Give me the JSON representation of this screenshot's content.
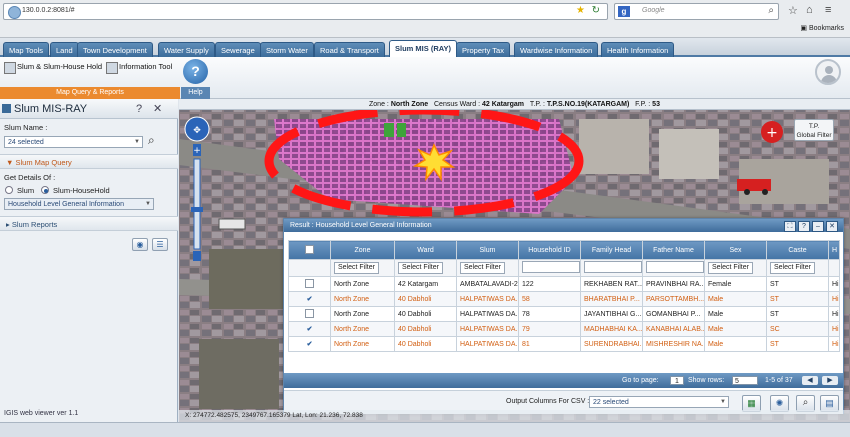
{
  "browser": {
    "url": "130.0.0.2:8081/#",
    "search_placeholder": "Google",
    "bookmarks_label": "Bookmarks"
  },
  "tabs": [
    {
      "label": "Map Tools"
    },
    {
      "label": "Land"
    },
    {
      "label": "Town Development"
    },
    {
      "label": "Water Supply"
    },
    {
      "label": "Sewerage"
    },
    {
      "label": "Storm Water"
    },
    {
      "label": "Road & Transport"
    },
    {
      "label": "Slum MIS (RAY)"
    },
    {
      "label": "Property Tax"
    },
    {
      "label": "Wardwise Information"
    },
    {
      "label": "Health Information"
    }
  ],
  "ribbon": {
    "slum_button": "Slum & Slum-House Hold",
    "info_button": "Information Tool",
    "group1_label": "Map Query & Reports",
    "group2_label": "Help"
  },
  "left_panel": {
    "title": "Slum MIS-RAY",
    "slum_name_label": "Slum Name :",
    "slum_name_value": "24 selected",
    "query_section": "Slum Map Query",
    "details_label": "Get Details Of :",
    "radio_slum": "Slum",
    "radio_household": "Slum-HouseHold",
    "info_select": "Household Level General Information",
    "reports_section": "Slum Reports"
  },
  "map": {
    "zone_label": "Zone :",
    "zone_value": "North Zone",
    "ward_label": "Census Ward :",
    "ward_value": "42 Katargam",
    "tp_label": "T.P. :",
    "tp_value": "T.P.S.NO.19(KATARGAM)",
    "fp_label": "F.P. :",
    "fp_value": "53",
    "global_filter_line1": "T.P.",
    "global_filter_line2": "Global Filter",
    "coords": "X: 274772.482575, 2349767.165379  Lat, Lon: 21.236, 72.838",
    "version": "IGIS web viewer ver 1.1"
  },
  "grid": {
    "title": "Result : Household Level General Information",
    "columns": [
      "Zone",
      "Ward",
      "Slum",
      "Household ID",
      "Family Head",
      "Father Name",
      "Sex",
      "Caste",
      "H"
    ],
    "filter_label": "Select Filter",
    "rows": [
      {
        "zone": "North Zone",
        "ward": "42 Katargam",
        "slum": "AMBATALAVADI-2",
        "hid": "122",
        "head": "REKHABEN RAT...",
        "father": "PRAVINBHAI RA...",
        "sex": "Female",
        "caste": "ST",
        "h": "Hi"
      },
      {
        "zone": "North Zone",
        "ward": "40 Dabholi",
        "slum": "HALPATIWAS DA...",
        "hid": "58",
        "head": "BHARATBHAI P...",
        "father": "PARSOTTAMBH...",
        "sex": "Male",
        "caste": "ST",
        "h": "Hi"
      },
      {
        "zone": "North Zone",
        "ward": "40 Dabholi",
        "slum": "HALPATIWAS DA...",
        "hid": "78",
        "head": "JAYANTIBHAI G...",
        "father": "GOMANBHAI P...",
        "sex": "Male",
        "caste": "ST",
        "h": "Hi"
      },
      {
        "zone": "North Zone",
        "ward": "40 Dabholi",
        "slum": "HALPATIWAS DA...",
        "hid": "79",
        "head": "MADHABHAI KA...",
        "father": "KANABHAI ALAB...",
        "sex": "Male",
        "caste": "SC",
        "h": "Hi"
      },
      {
        "zone": "North Zone",
        "ward": "40 Dabholi",
        "slum": "HALPATIWAS DA...",
        "hid": "81",
        "head": "SURENDRABHAI...",
        "father": "MISHRESHIR NA...",
        "sex": "Male",
        "caste": "ST",
        "h": "Hi"
      }
    ],
    "goto_label": "Go to page:",
    "goto_value": "1",
    "show_rows_label": "Show rows:",
    "show_rows_value": "5",
    "range": "1-5 of 37",
    "csv_label": "Output Columns For CSV :",
    "csv_value": "22 selected"
  }
}
